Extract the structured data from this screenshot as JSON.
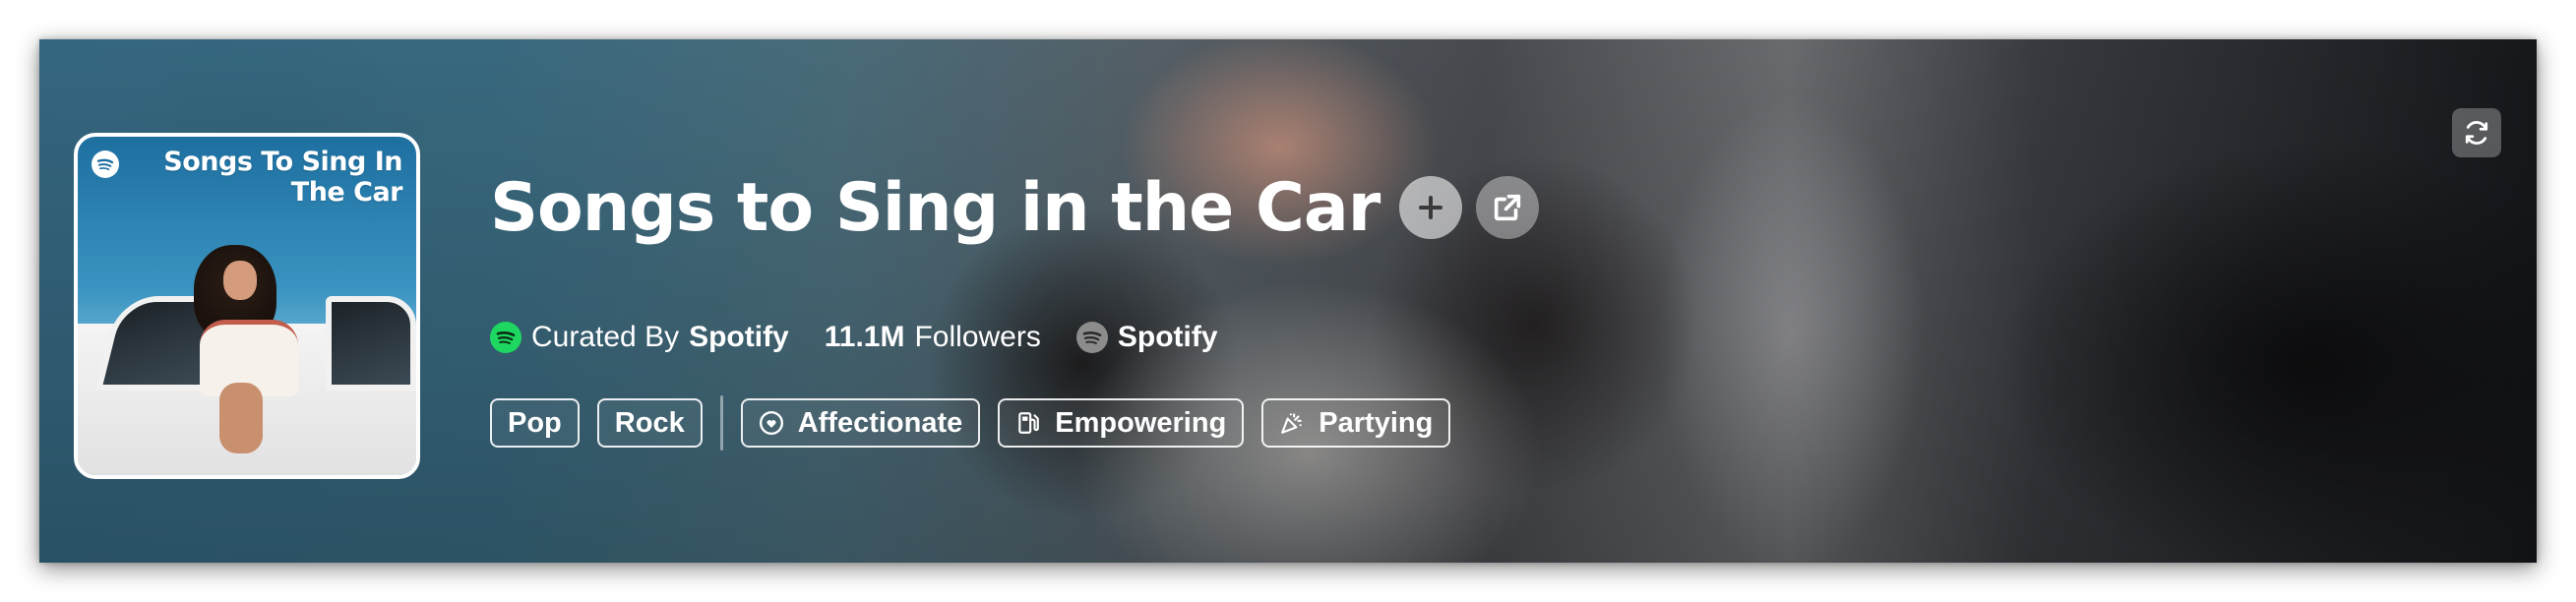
{
  "playlist": {
    "title": "Songs to Sing in the Car",
    "cover_title": "Songs To Sing In The Car",
    "curated_prefix": "Curated By",
    "curator": "Spotify",
    "followers_count": "11.1M",
    "followers_label": "Followers",
    "owner": "Spotify"
  },
  "tags": {
    "genres": [
      "Pop",
      "Rock"
    ],
    "moods": [
      {
        "label": "Affectionate",
        "icon": "heart-icon"
      },
      {
        "label": "Empowering",
        "icon": "fuel-pump-icon"
      },
      {
        "label": "Partying",
        "icon": "party-popper-icon"
      }
    ]
  },
  "actions": {
    "add_icon": "plus-icon",
    "open_icon": "external-link-icon",
    "refresh_icon": "refresh-icon"
  },
  "colors": {
    "spotify_green": "#1ed760",
    "text": "#ffffff"
  }
}
